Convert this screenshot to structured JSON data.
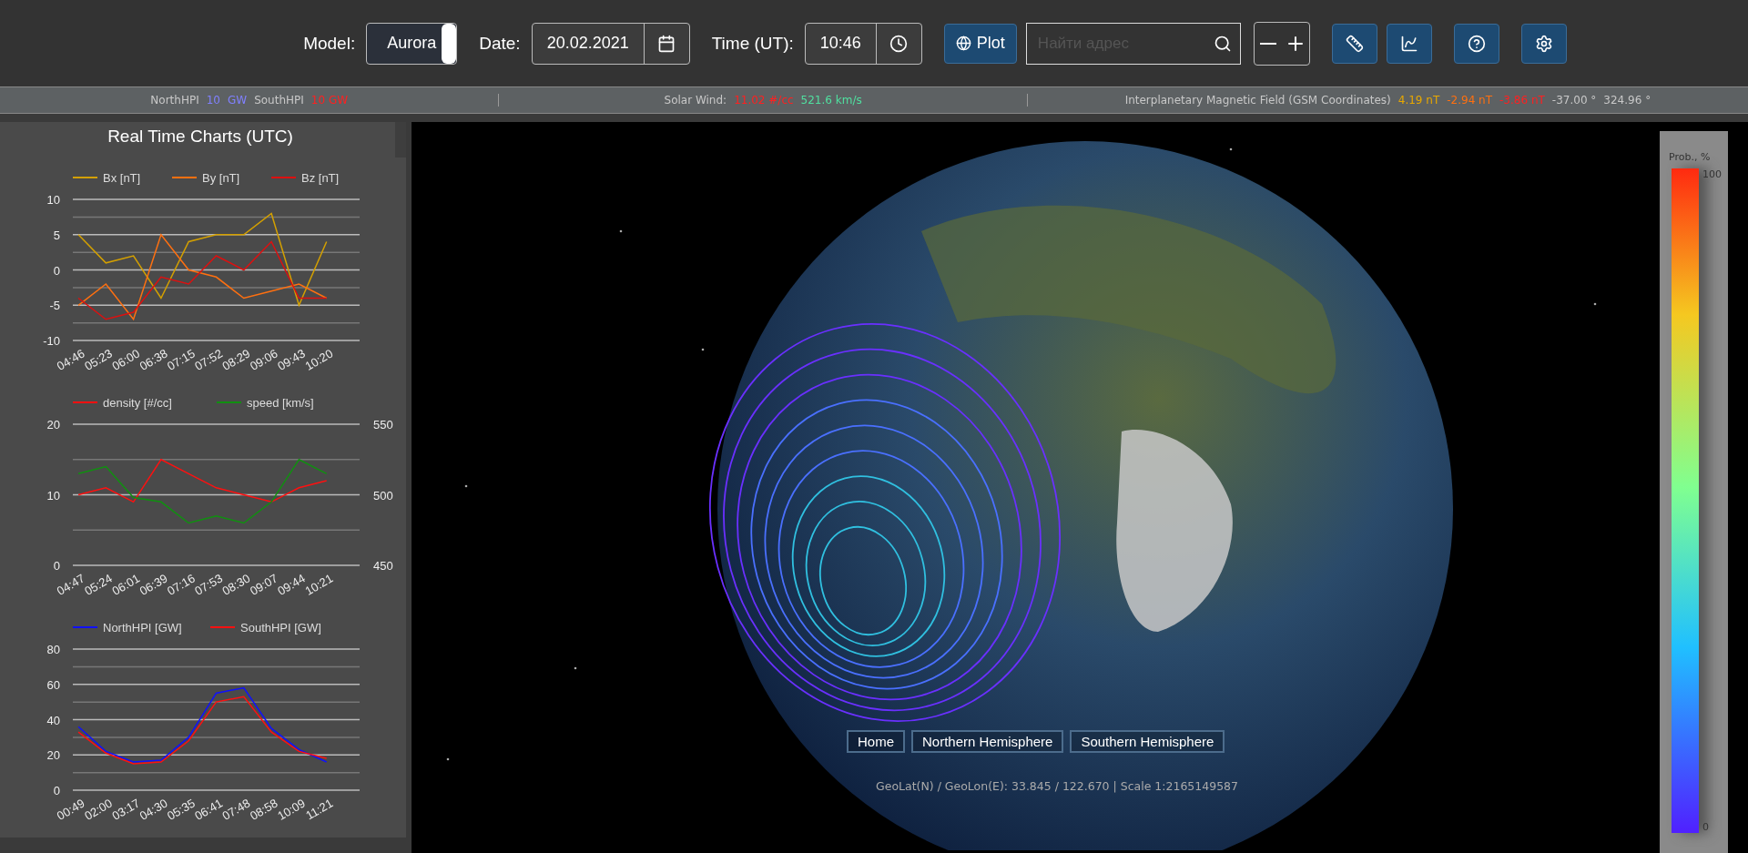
{
  "toolbar": {
    "model_label": "Model:",
    "model_value": "Aurora",
    "date_label": "Date:",
    "date_value": "20.02.2021",
    "time_label": "Time (UT):",
    "time_value": "10:46",
    "plot_button": "Plot",
    "search": {
      "placeholder": "Найти адрес"
    }
  },
  "status_bar": [
    {
      "items": [
        {
          "text": "NorthHPI",
          "color": "#c8c8c8"
        },
        {
          "text": "10",
          "color": "#8080ff"
        },
        {
          "text": "GW",
          "color": "#8080ff"
        },
        {
          "text": "SouthHPI",
          "color": "#c8c8c8"
        },
        {
          "text": "10 GW",
          "color": "#ff2020"
        }
      ]
    },
    {
      "items": [
        {
          "text": "Solar Wind:",
          "color": "#c8c8c8"
        },
        {
          "text": "11.02 #/cc",
          "color": "#ff2020"
        },
        {
          "text": "521.6 km/s",
          "color": "#50e0a0"
        }
      ]
    },
    {
      "items": [
        {
          "text": "Interplanetary Magnetic Field (GSM Coordinates)",
          "color": "#c8c8c8"
        },
        {
          "text": "4.19 nT",
          "color": "#e8a800"
        },
        {
          "text": "-2.94 nT",
          "color": "#ff7010"
        },
        {
          "text": "-3.86 nT",
          "color": "#ff2020"
        },
        {
          "text": "-37.00 °",
          "color": "#c8c8c8"
        },
        {
          "text": "324.96 °",
          "color": "#c8c8c8"
        }
      ]
    }
  ],
  "charts_panel": {
    "title": "Real Time Charts (UTC)",
    "charts": [
      {
        "chart_data": {
          "type": "line",
          "grid": true,
          "legend": "top",
          "ylim": [
            -10,
            10
          ],
          "yticks": [
            -10,
            -5,
            0,
            5,
            10
          ],
          "ref_lines": [
            {
              "axis": "y",
              "value": -7.5
            },
            {
              "axis": "y",
              "value": -2.5
            },
            {
              "axis": "y",
              "value": 2.5
            },
            {
              "axis": "y",
              "value": 7.5
            }
          ],
          "categories": [
            "04:46",
            "05:23",
            "06:00",
            "06:38",
            "07:15",
            "07:52",
            "08:29",
            "09:06",
            "09:43",
            "10:20"
          ],
          "series": [
            {
              "name": "Bx [nT]",
              "color": "#d4a000",
              "values": [
                5,
                1,
                2,
                -4,
                4,
                5,
                5,
                8,
                -5,
                4
              ]
            },
            {
              "name": "By [nT]",
              "color": "#ff7010",
              "values": [
                -5,
                -2,
                -7,
                5,
                0,
                -1,
                -4,
                -3,
                -2,
                -4
              ]
            },
            {
              "name": "Bz [nT]",
              "color": "#dd1010",
              "values": [
                -4,
                -7,
                -6,
                -1,
                -2,
                2,
                0,
                4,
                -4,
                -4
              ]
            }
          ]
        }
      },
      {
        "chart_data": {
          "type": "line",
          "grid": true,
          "legend": "top",
          "ylim": [
            0,
            20
          ],
          "yticks": [
            0,
            10,
            20
          ],
          "ref_lines": [
            {
              "axis": "y",
              "value": 5
            },
            {
              "axis": "y",
              "value": 15
            }
          ],
          "y2lim": [
            450,
            550
          ],
          "y2ticks": [
            450,
            500,
            550
          ],
          "categories": [
            "04:47",
            "05:24",
            "06:01",
            "06:39",
            "07:16",
            "07:53",
            "08:30",
            "09:07",
            "09:44",
            "10:21"
          ],
          "series": [
            {
              "name": "density [#/cc]",
              "color": "#ff1010",
              "values": [
                10,
                11,
                9,
                15,
                13,
                11,
                10,
                9,
                11,
                12
              ]
            },
            {
              "name": "speed [km/s]",
              "color": "#109010",
              "axis": "y2",
              "values": [
                515,
                520,
                498,
                495,
                480,
                485,
                480,
                495,
                525,
                515
              ]
            }
          ]
        }
      },
      {
        "chart_data": {
          "type": "line",
          "grid": true,
          "legend": "top",
          "ylim": [
            0,
            80
          ],
          "yticks": [
            0,
            20,
            40,
            60,
            80
          ],
          "ref_lines": [
            {
              "axis": "y",
              "value": 10
            },
            {
              "axis": "y",
              "value": 30
            },
            {
              "axis": "y",
              "value": 50
            },
            {
              "axis": "y",
              "value": 70
            }
          ],
          "categories": [
            "00:49",
            "02:00",
            "03:17",
            "04:30",
            "05:35",
            "06:41",
            "07:48",
            "08:58",
            "10:09",
            "11:21"
          ],
          "series": [
            {
              "name": "NorthHPI [GW]",
              "color": "#1010ff",
              "values": [
                36,
                22,
                16,
                17,
                30,
                55,
                58,
                35,
                23,
                16
              ]
            },
            {
              "name": "SouthHPI [GW]",
              "color": "#ff1010",
              "values": [
                33,
                21,
                15,
                16,
                28,
                50,
                53,
                33,
                22,
                18
              ]
            }
          ]
        }
      }
    ]
  },
  "map": {
    "buttons": [
      "Home",
      "Northern Hemisphere",
      "Southern Hemisphere"
    ],
    "coordinates": "GeoLat(N) / GeoLon(E): 33.845 / 122.670 | Scale 1:2165149587",
    "legend": {
      "title": "Prob., %",
      "max": "100",
      "min": "0"
    }
  }
}
